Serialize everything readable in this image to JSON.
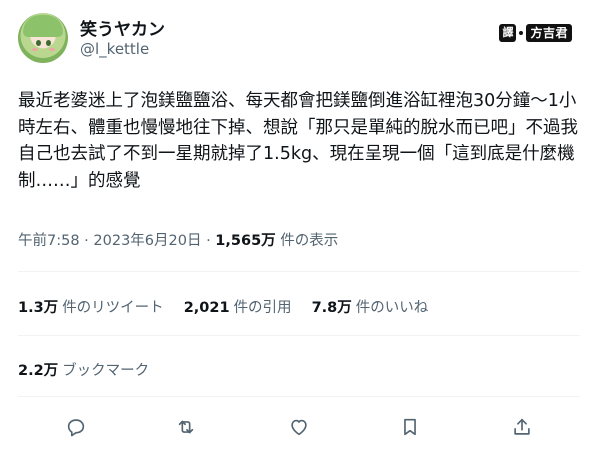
{
  "author": {
    "display_name": "笑うヤカン",
    "handle": "@l_kettle"
  },
  "translator_badge": {
    "tag": "譯",
    "name": "方吉君"
  },
  "tweet": {
    "text": "最近老婆迷上了泡鎂鹽鹽浴、每天都會把鎂鹽倒進浴缸裡泡30分鐘～1小時左右、體重也慢慢地往下掉、想說「那只是單純的脫水而已吧」不過我自己也去試了不到一星期就掉了1.5kg、現在呈現一個「這到底是什麼機制……」的感覺"
  },
  "meta": {
    "time": "午前7:58",
    "sep1": " · ",
    "date": "2023年6月20日",
    "sep2": " · ",
    "views_count": "1,565万",
    "views_label": " 件の表示"
  },
  "stats": {
    "retweets": {
      "count": "1.3万",
      "label": "件のリツイート"
    },
    "quotes": {
      "count": "2,021",
      "label": "件の引用"
    },
    "likes": {
      "count": "7.8万",
      "label": "件のいいね"
    }
  },
  "bookmarks": {
    "count": "2.2万",
    "label": "ブックマーク"
  },
  "actions": {
    "icons": [
      "reply-icon",
      "retweet-icon",
      "like-icon",
      "bookmark-icon",
      "share-icon"
    ]
  }
}
